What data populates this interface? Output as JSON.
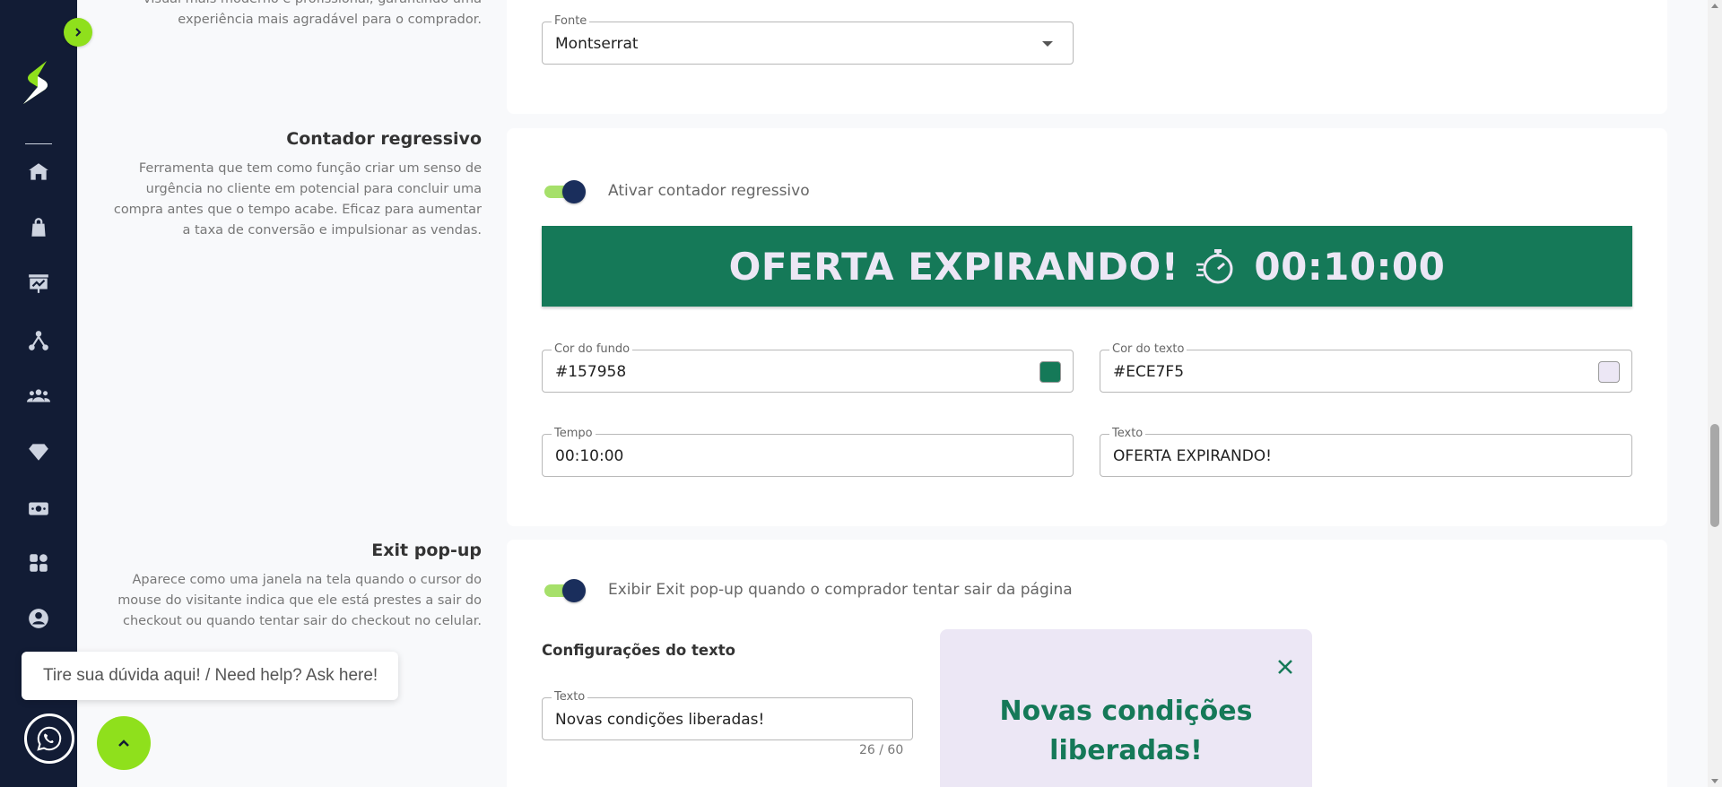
{
  "font_section": {
    "desc_partial": "visual mais moderno e profissional, garantindo uma experiência mais agradável para o comprador.",
    "font_field": {
      "label": "Fonte",
      "value": "Montserrat"
    }
  },
  "countdown": {
    "title": "Contador regressivo",
    "description": "Ferramenta que tem como função criar um senso de urgência no cliente em potencial para concluir uma compra antes que o tempo acabe. Eficaz para aumentar a taxa de conversão e impulsionar as vendas.",
    "toggle_label": "Ativar contador regressivo",
    "toggle_on": true,
    "banner_text": "OFERTA EXPIRANDO!",
    "banner_time": "00:10:00",
    "bg_color": {
      "label": "Cor do fundo",
      "value": "#157958"
    },
    "text_color": {
      "label": "Cor do texto",
      "value": "#ECE7F5"
    },
    "time_field": {
      "label": "Tempo",
      "value": "00:10:00"
    },
    "text_field": {
      "label": "Texto",
      "value": "OFERTA EXPIRANDO!"
    }
  },
  "exit_popup": {
    "title": "Exit pop-up",
    "description": "Aparece como uma janela na tela quando o cursor do mouse do visitante indica que ele está prestes a sair do checkout ou quando tentar sair do checkout no celular.",
    "toggle_label": "Exibir Exit pop-up quando o comprador tentar sair da página",
    "toggle_on": true,
    "text_config_heading": "Configurações do texto",
    "text_field": {
      "label": "Texto",
      "value": "Novas condições liberadas!"
    },
    "char_counter": "26 / 60",
    "preview_title": "Novas condições liberadas!"
  },
  "help": {
    "bubble_text": "Tire sua dúvida aqui! / Need help? Ask here!"
  },
  "sidebar": {
    "icons": [
      "home-icon",
      "shopping-bag-icon",
      "dashboard-chart-icon",
      "affiliates-network-icon",
      "users-group-icon",
      "diamond-icon",
      "money-icon",
      "apps-grid-icon",
      "account-circle-icon"
    ]
  },
  "colors": {
    "sidebar_bg": "#121c35",
    "accent_green": "#8fe01c",
    "banner_bg": "#157958",
    "banner_text": "#ECE7F5"
  }
}
